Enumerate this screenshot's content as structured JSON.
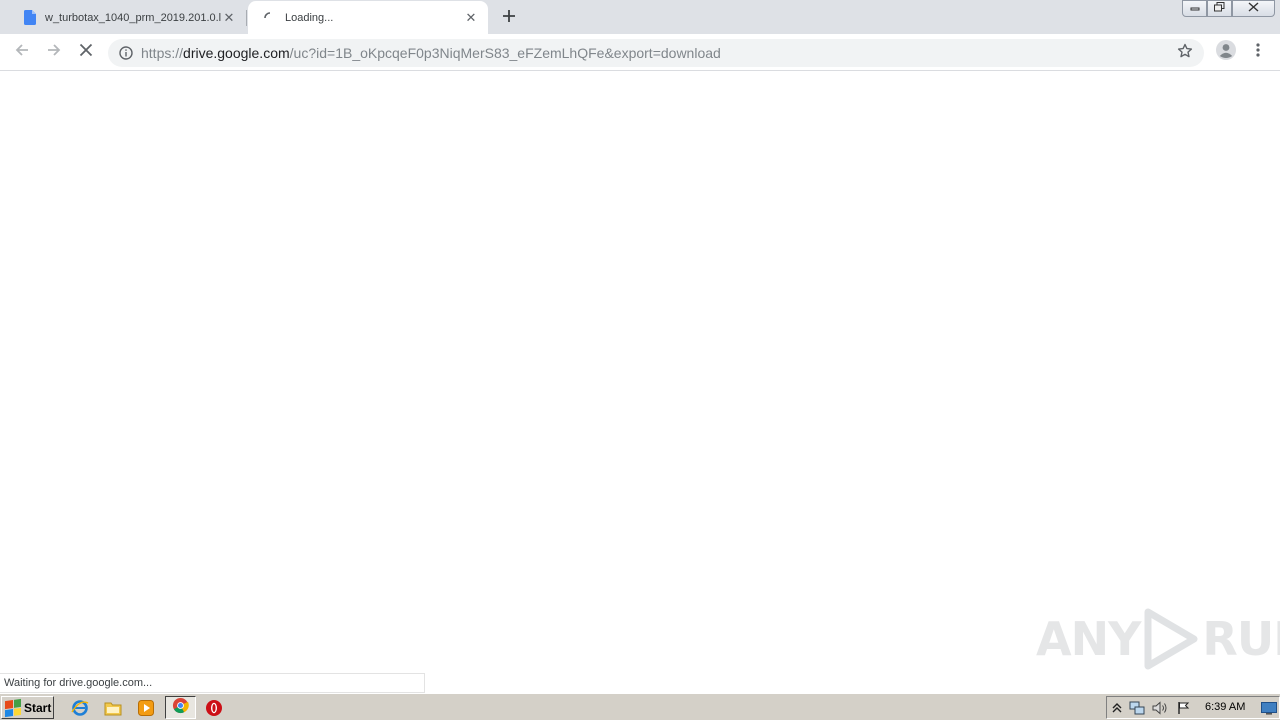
{
  "browser": {
    "tabs": [
      {
        "title": "w_turbotax_1040_prm_2019.201.0.l",
        "icon": "google-docs-icon",
        "active": false
      },
      {
        "title": "Loading...",
        "icon": "loading-spinner-icon",
        "active": true
      }
    ],
    "new_tab_icon": "plus-icon",
    "window_controls": [
      "minimize-icon",
      "restore-icon",
      "close-icon"
    ]
  },
  "toolbar": {
    "back_icon": "back-arrow-icon",
    "forward_icon": "forward-arrow-icon",
    "stop_icon": "stop-icon",
    "url": {
      "scheme": "https://",
      "host": "drive.google.com",
      "path": "/uc?id=1B_oKpcqeF0p3NiqMerS83_eFZemLhQFe&export=download"
    },
    "bookmark_icon": "star-icon",
    "profile_icon": "profile-icon",
    "menu_icon": "kebab-menu-icon"
  },
  "status_bar": {
    "text": "Waiting for drive.google.com..."
  },
  "watermark": {
    "left": "ANY",
    "right": "RUN"
  },
  "taskbar": {
    "start_label": "Start",
    "quick_launch": [
      "internet-explorer-icon",
      "file-explorer-icon",
      "media-player-icon",
      "chrome-icon",
      "opera-icon"
    ],
    "tray_icons": [
      "show-hidden-icons-icon",
      "network-icon",
      "volume-icon",
      "action-center-flag-icon"
    ],
    "clock": "6:39 AM"
  }
}
